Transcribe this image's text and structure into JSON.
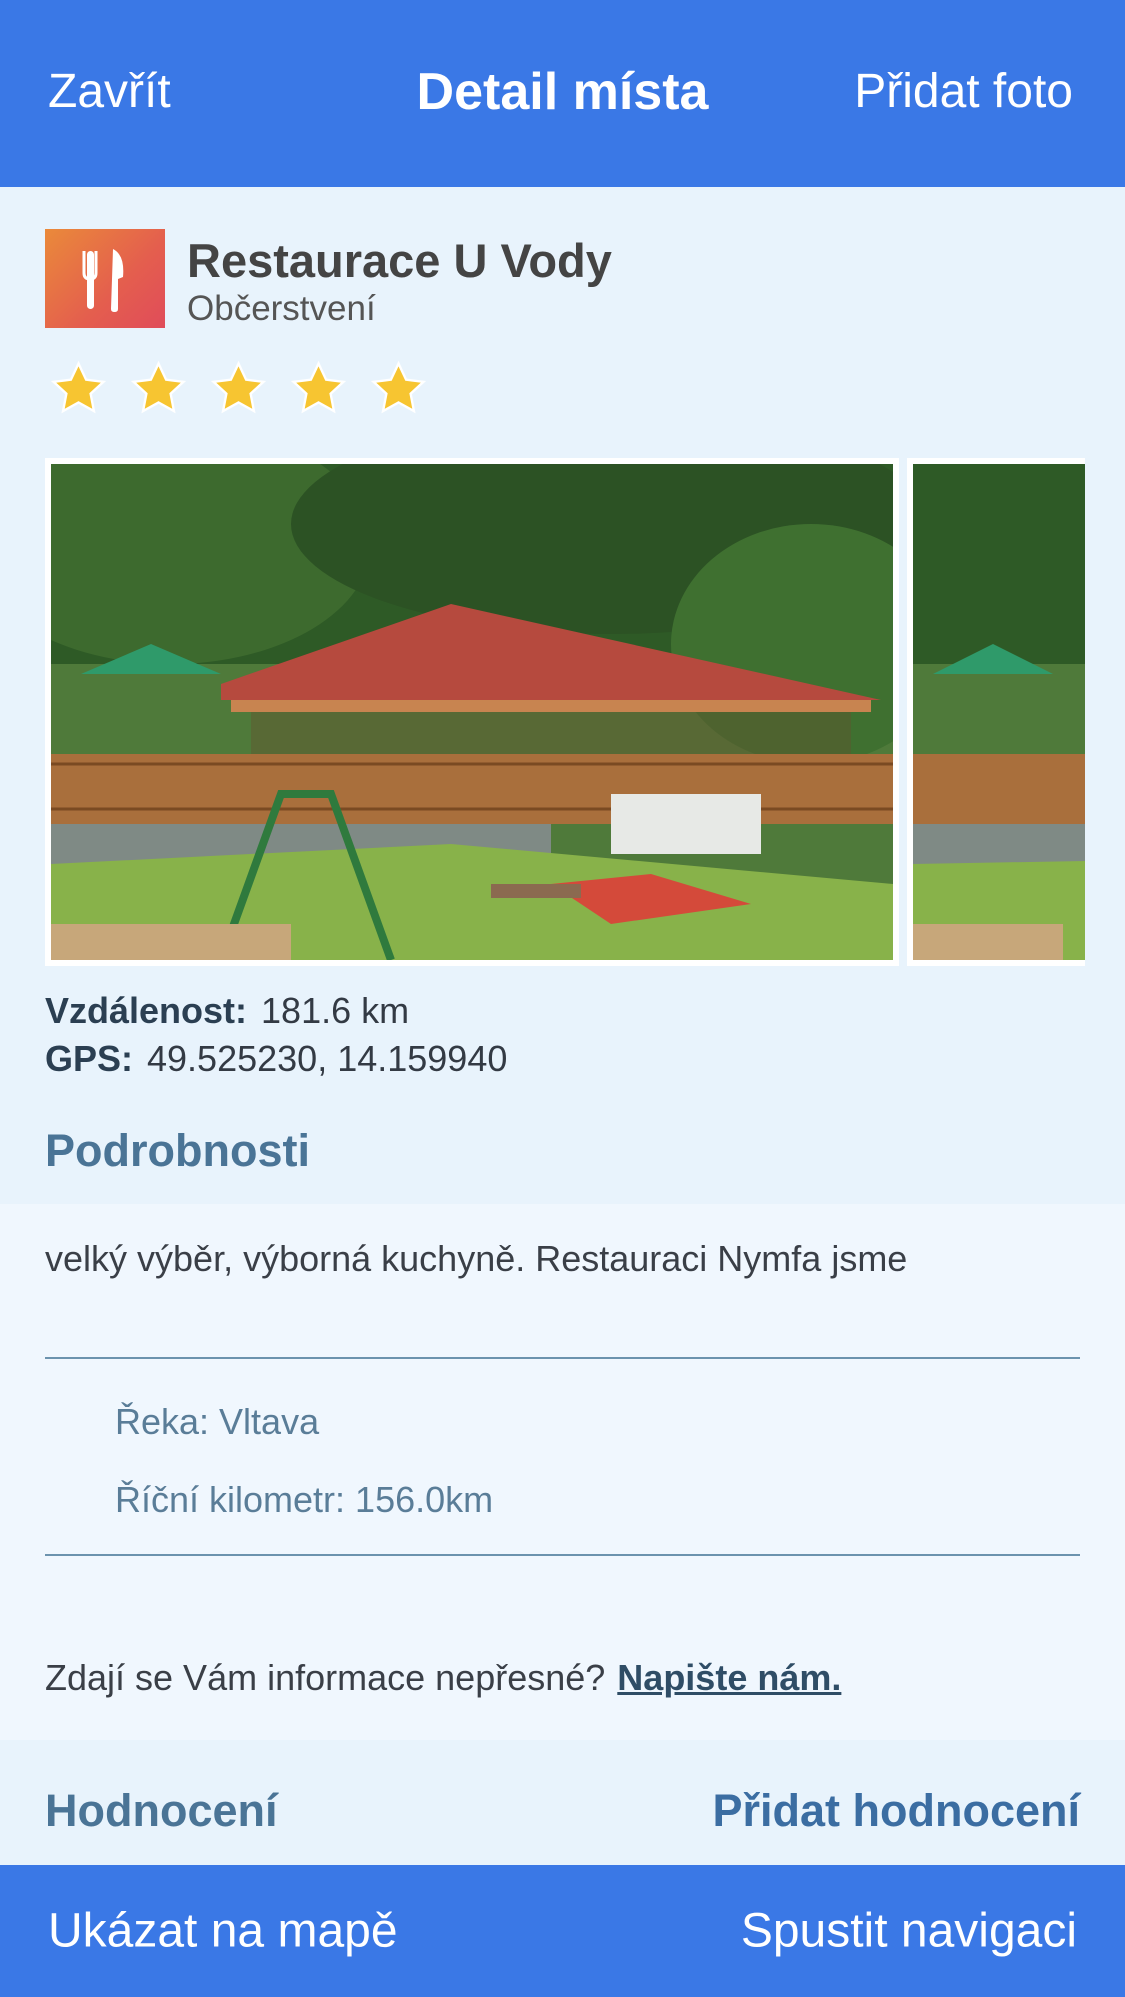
{
  "header": {
    "close_label": "Zavřít",
    "title": "Detail místa",
    "add_photo_label": "Přidat foto"
  },
  "place": {
    "name": "Restaurace U Vody",
    "category": "Občerstvení",
    "icon": "fork-knife-icon",
    "rating_stars": 5
  },
  "info": {
    "distance_label": "Vzdálenost:",
    "distance_value": "181.6 km",
    "gps_label": "GPS:",
    "gps_value": "49.525230, 14.159940"
  },
  "details": {
    "title": "Podrobnosti",
    "description": "velký výběr, výborná kuchyně. Restauraci Nymfa jsme",
    "river": "Řeka: Vltava",
    "river_km": "Říční kilometr: 156.0km",
    "report_text": "Zdají se Vám informace nepřesné?",
    "report_link": "Napište nám."
  },
  "rating": {
    "title": "Hodnocení",
    "add_label": "Přidat hodnocení"
  },
  "footer": {
    "show_on_map": "Ukázat na mapě",
    "start_navigation": "Spustit navigaci"
  },
  "colors": {
    "bar_blue": "#3a78e6",
    "background": "#e8f3fc",
    "star_yellow": "#f7c531",
    "section_blue": "#4a7496"
  }
}
